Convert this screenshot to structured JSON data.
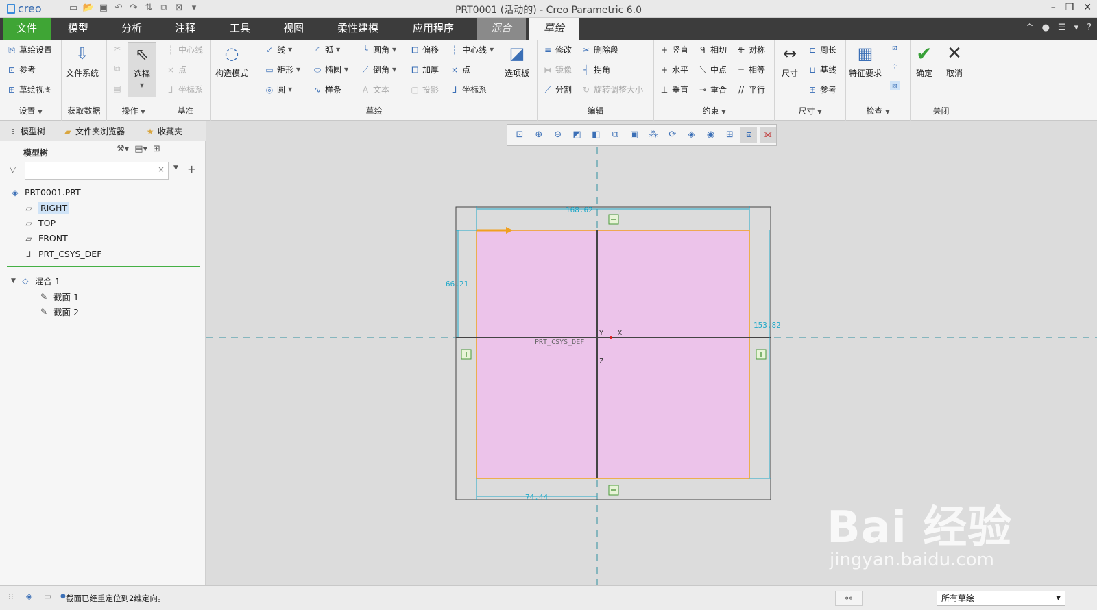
{
  "titlebar": {
    "logo": "creo",
    "title": "PRT0001 (活动的) - Creo Parametric 6.0",
    "min": "–",
    "max": "❐",
    "close": "✕"
  },
  "menubar": {
    "tabs": [
      "文件",
      "模型",
      "分析",
      "注释",
      "工具",
      "视图",
      "柔性建模",
      "应用程序",
      "混合",
      "草绘"
    ],
    "right": [
      "^",
      "●",
      "☰",
      "▾",
      "?"
    ]
  },
  "ribbon": {
    "setup": {
      "items": [
        "草绘设置",
        "参考",
        "草绘视图"
      ],
      "label": "设置"
    },
    "getdata": {
      "big": "文件系统",
      "label": "获取数据"
    },
    "ops": {
      "big": "选择",
      "label": "操作"
    },
    "datum": {
      "items": [
        "中心线",
        "点",
        "坐标系"
      ],
      "label": "基准"
    },
    "construct": {
      "big": "构造模式"
    },
    "sketch": {
      "col1": [
        "线",
        "矩形",
        "圆"
      ],
      "col2": [
        "弧",
        "椭圆",
        "样条"
      ],
      "col3": [
        "圆角",
        "倒角",
        "文本"
      ],
      "col4": [
        "偏移",
        "加厚",
        "投影"
      ],
      "col5": [
        "中心线",
        "点",
        "坐标系"
      ],
      "palette": "选项板",
      "label": "草绘"
    },
    "edit": {
      "items": [
        "修改",
        "镜像",
        "分割"
      ],
      "items2": [
        "删除段",
        "拐角",
        "旋转调整大小"
      ],
      "label": "编辑"
    },
    "constrain": {
      "col1": [
        "竖直",
        "水平",
        "垂直"
      ],
      "col2": [
        "相切",
        "中点",
        "重合"
      ],
      "col3": [
        "对称",
        "相等",
        "平行"
      ],
      "label": "约束"
    },
    "dimension": {
      "big": "尺寸",
      "items": [
        "周长",
        "基线",
        "参考"
      ],
      "label": "尺寸"
    },
    "inspect": {
      "big": "特征要求",
      "label": "检查"
    },
    "close": {
      "ok": "确定",
      "cancel": "取消",
      "label": "关闭"
    }
  },
  "leftpanel": {
    "tabs": [
      "模型树",
      "文件夹浏览器",
      "收藏夹"
    ],
    "tree_header": "模型树",
    "search_placeholder": "",
    "tree": [
      {
        "label": "PRT0001.PRT",
        "icon": "part-icon"
      },
      {
        "label": "RIGHT",
        "icon": "plane-icon"
      },
      {
        "label": "TOP",
        "icon": "plane-icon"
      },
      {
        "label": "FRONT",
        "icon": "plane-icon"
      },
      {
        "label": "PRT_CSYS_DEF",
        "icon": "csys-icon"
      },
      {
        "label": "混合 1",
        "icon": "blend-icon"
      },
      {
        "label": "截面 1",
        "icon": "section-icon"
      },
      {
        "label": "截面 2",
        "icon": "section-icon"
      }
    ]
  },
  "sketch": {
    "dims": [
      "168.62",
      "66.21",
      "153.82",
      "74.44"
    ],
    "csys_label": "PRT_CSYS_DEF",
    "axis_x": "X",
    "axis_y": "Y",
    "axis_z": "Z",
    "fill_color": "#ecc3ea",
    "outline_color": "#f0a020",
    "dim_color": "#20a8c8"
  },
  "status": {
    "message": "截面已经重定位到2维定向。",
    "filter": "所有草绘"
  },
  "watermark": {
    "line1": "Bai 经验",
    "line2": "jingyan.baidu.com"
  }
}
